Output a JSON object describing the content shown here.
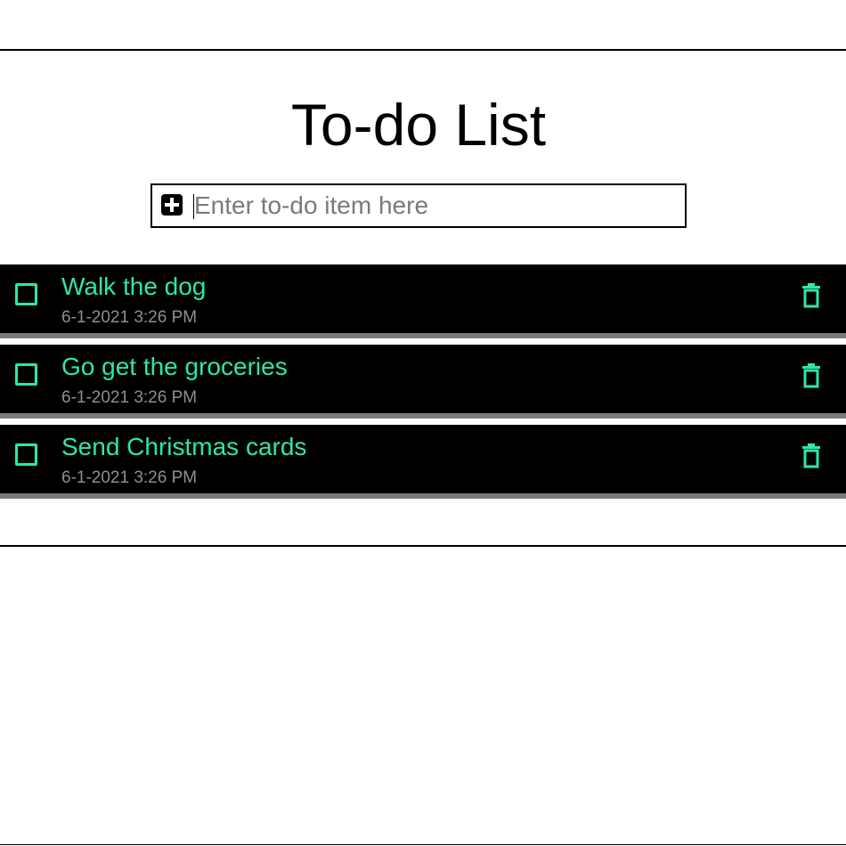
{
  "header": {
    "title": "To-do List"
  },
  "add_item": {
    "placeholder": "Enter to-do item here",
    "value": "",
    "icon": "plus-square-icon"
  },
  "todos": [
    {
      "text": "Walk the dog",
      "timestamp": "6-1-2021 3:26 PM",
      "completed": false
    },
    {
      "text": "Go get the groceries",
      "timestamp": "6-1-2021 3:26 PM",
      "completed": false
    },
    {
      "text": "Send Christmas cards",
      "timestamp": "6-1-2021 3:26 PM",
      "completed": false
    }
  ],
  "colors": {
    "accent": "#2de8a4",
    "item_background": "#000000",
    "item_border": "#7b7b7b",
    "timestamp": "#8e8e8e"
  },
  "icons": {
    "checkbox": "checkbox-icon",
    "delete": "trash-icon"
  }
}
